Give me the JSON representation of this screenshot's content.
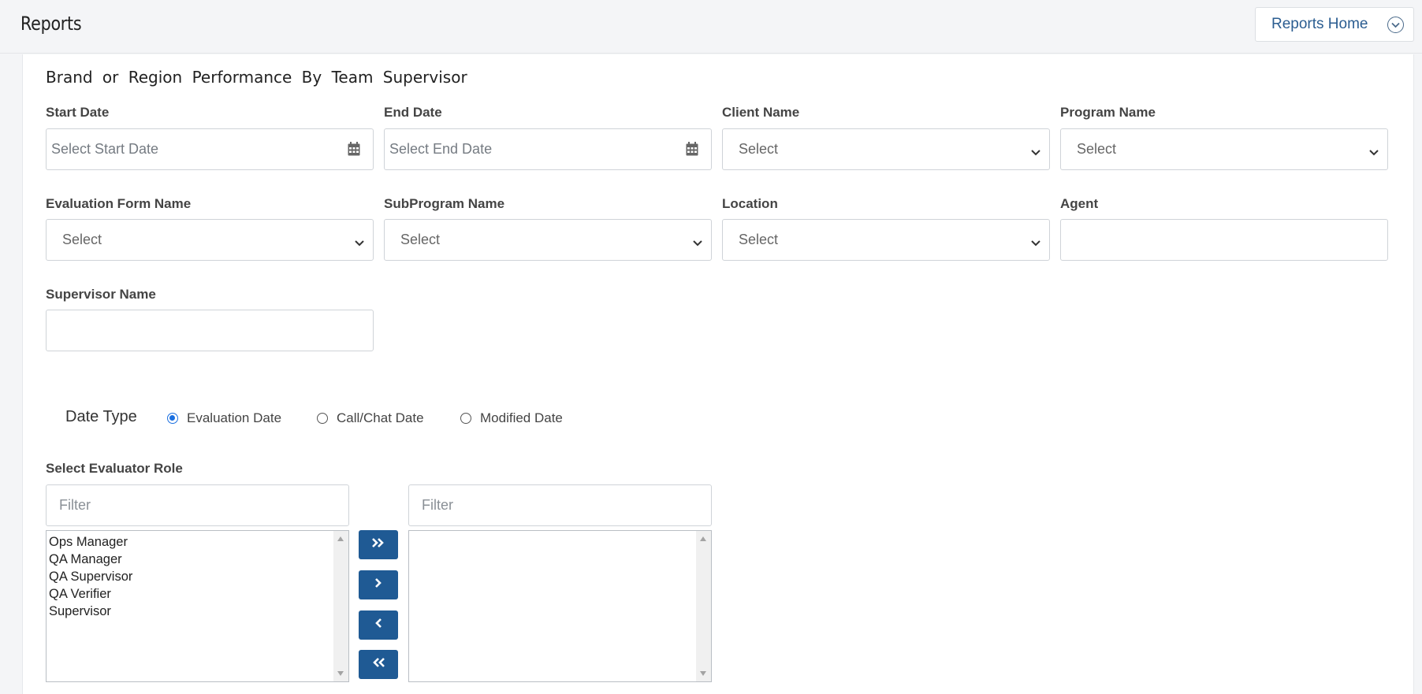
{
  "header": {
    "title": "Reports",
    "reports_home_label": "Reports Home"
  },
  "report": {
    "title": "Brand or Region Performance By Team Supervisor"
  },
  "filters": {
    "start_date": {
      "label": "Start Date",
      "placeholder": "Select Start Date"
    },
    "end_date": {
      "label": "End Date",
      "placeholder": "Select End Date"
    },
    "client_name": {
      "label": "Client Name",
      "value": "Select"
    },
    "program_name": {
      "label": "Program Name",
      "value": "Select"
    },
    "evaluation_form_name": {
      "label": "Evaluation Form Name",
      "value": "Select"
    },
    "subprogram_name": {
      "label": "SubProgram Name",
      "value": "Select"
    },
    "location": {
      "label": "Location",
      "value": "Select"
    },
    "agent": {
      "label": "Agent",
      "value": ""
    },
    "supervisor_name": {
      "label": "Supervisor Name",
      "value": ""
    }
  },
  "date_type": {
    "label": "Date Type",
    "options": [
      {
        "label": "Evaluation Date",
        "selected": true
      },
      {
        "label": "Call/Chat Date",
        "selected": false
      },
      {
        "label": "Modified Date",
        "selected": false
      }
    ]
  },
  "evaluator_role": {
    "label": "Select Evaluator Role",
    "left_filter_placeholder": "Filter",
    "right_filter_placeholder": "Filter",
    "available": [
      "Ops Manager",
      "QA Manager",
      "QA Supervisor",
      "QA Verifier",
      "Supervisor"
    ],
    "selected": []
  },
  "colors": {
    "accent": "#1f5a94",
    "link": "#2b5d91",
    "radio_selected": "#1a6fe0"
  }
}
